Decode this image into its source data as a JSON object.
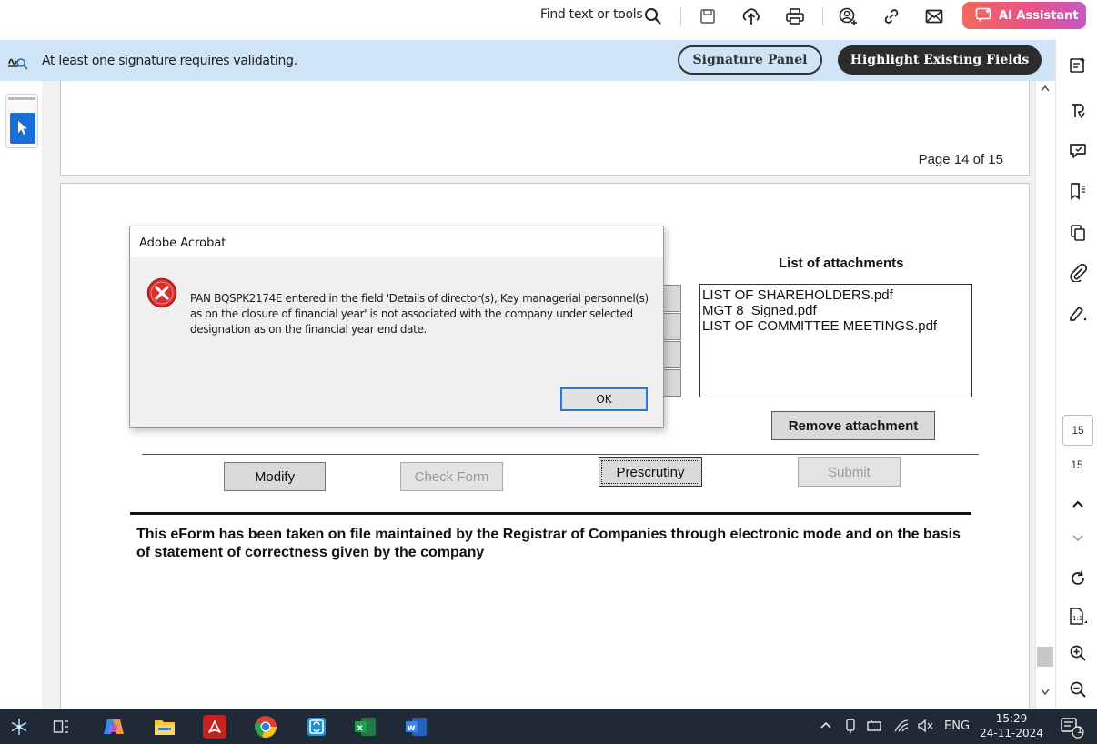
{
  "toolbar": {
    "find_label": "Find text or tools",
    "ai_label": "AI Assistant",
    "icons": [
      "search-icon",
      "save-icon",
      "upload-icon",
      "print-icon",
      "share-user-icon",
      "link-icon",
      "email-icon",
      "ai-assistant-icon"
    ]
  },
  "signature_bar": {
    "message": "At least one signature requires validating.",
    "signature_panel_label": "Signature Panel",
    "highlight_fields_label": "Highlight Existing Fields"
  },
  "document": {
    "page_indicator": "Page 14 of 15",
    "attachments_title": "List of attachments",
    "attachments": [
      "LIST OF SHAREHOLDERS.pdf",
      "MGT 8_Signed.pdf",
      "LIST OF COMMITTEE MEETINGS.pdf"
    ],
    "remove_attachment_label": "Remove attachment",
    "buttons": {
      "modify": "Modify",
      "check_form": "Check Form",
      "prescrutiny": "Prescrutiny",
      "submit": "Submit"
    },
    "footer_note": "This eForm has been taken on file maintained by the Registrar of Companies through electronic mode and on the basis of statement of correctness given by the company"
  },
  "dialog": {
    "title": "Adobe Acrobat",
    "message": "PAN BQSPK2174E entered in the field 'Details of director(s), Key managerial personnel(s) as on the closure of financial year' is not associated with the company under selected designation as on the financial year end date.",
    "ok_label": "OK"
  },
  "right_rail": {
    "current_page": "15",
    "total_pages": "15"
  },
  "taskbar": {
    "language": "ENG",
    "time": "15:29",
    "date": "24-11-2024",
    "notification_count": "1",
    "apps": [
      "widgets-icon",
      "task-view-icon",
      "copilot-icon",
      "file-explorer-icon",
      "acrobat-icon",
      "chrome-icon",
      "store-icon",
      "excel-icon",
      "word-icon"
    ]
  },
  "colors": {
    "signature_bar_bg": "#cfe4f6",
    "highlight_button_bg": "#2c2c2c",
    "ok_border": "#2a7ad4",
    "error_red": "#d9302c",
    "taskbar_bg": "#1f2a36"
  }
}
